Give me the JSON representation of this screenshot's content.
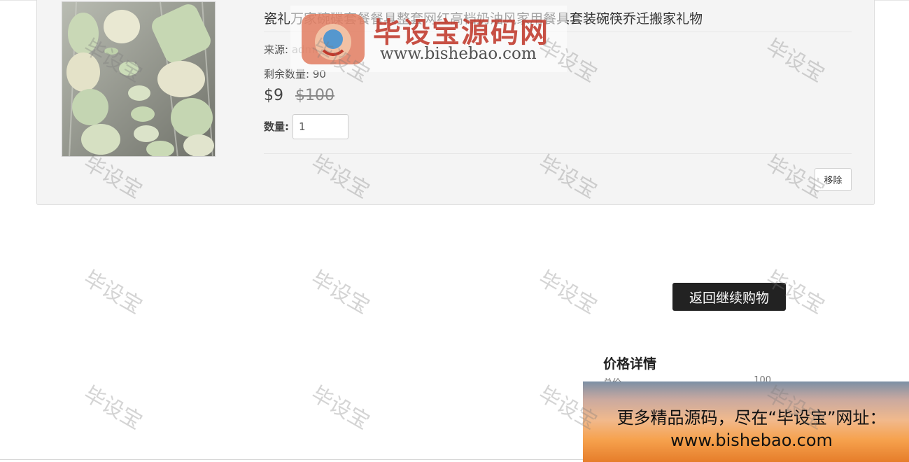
{
  "product": {
    "title": "瓷礼万家碗碟套餐餐具整套网红高档奶油风家用餐具套装碗筷乔迁搬家礼物",
    "source_label": "来源:",
    "source_value": "admin",
    "stock_label": "剩余数量:",
    "stock_value": "90",
    "price_current": "$9",
    "price_original": "$100",
    "quantity_label": "数量:",
    "quantity_value": "1",
    "remove_label": "移除"
  },
  "actions": {
    "continue_shopping": "返回继续购物"
  },
  "price_details": {
    "heading": "价格详情",
    "first_row_label": "总价",
    "first_row_value": "100"
  },
  "watermark": {
    "text": "毕设宝",
    "logo_title": "毕设宝源码网",
    "logo_url": "www.bishebao.com"
  },
  "promo": {
    "line1": "更多精品源码，尽在“毕设宝”网址：",
    "line2": "www.bishebao.com"
  },
  "colors": {
    "button_dark": "#222222",
    "panel_bg": "#f4f4f4",
    "brand_red": "#c0392b"
  }
}
